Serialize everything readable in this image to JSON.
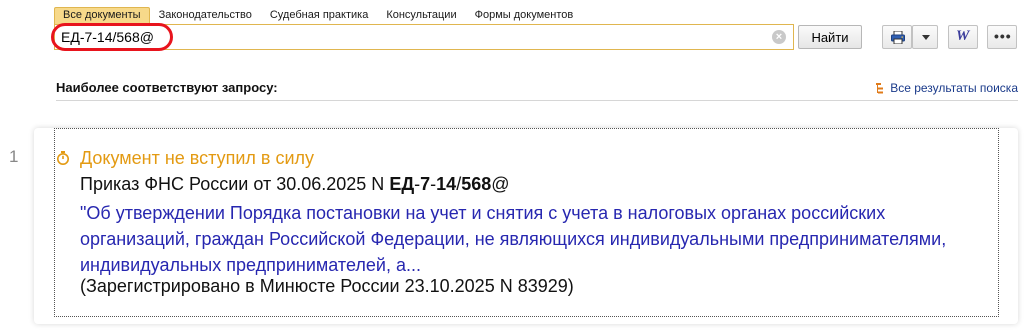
{
  "tabs": [
    {
      "label": "Все документы",
      "active": true
    },
    {
      "label": "Законодательство",
      "active": false
    },
    {
      "label": "Судебная практика",
      "active": false
    },
    {
      "label": "Консультации",
      "active": false
    },
    {
      "label": "Формы документов",
      "active": false
    }
  ],
  "search": {
    "value": "ЕД-7-14/568@",
    "clear_glyph": "×",
    "find_label": "Найти"
  },
  "toolbar": {
    "icons": [
      "print-icon",
      "chevron-down-icon",
      "word-icon",
      "more-icon"
    ],
    "word_glyph": "W",
    "more_glyph": "•••"
  },
  "results": {
    "heading": "Наиболее соответствуют запросу:",
    "all_results_label": "Все результаты поиска"
  },
  "items": [
    {
      "number": "1",
      "status": "Документ не вступил в силу",
      "title_prefix": "Приказ ФНС России от 30.06.2025 N ",
      "title_parts": [
        "ЕД",
        "-",
        "7",
        "-",
        "14",
        "/",
        "568",
        "@"
      ],
      "description": "\"Об утверждении Порядка постановки на учет и снятия с учета в налоговых органах российских организаций, граждан Российской Федерации, не являющихся индивидуальными предпринимателями, индивидуальных предпринимателей, а...",
      "note": "(Зарегистрировано в Минюсте России 23.10.2025 N 83929)"
    }
  ],
  "colors": {
    "tab_active": "#f7d98a",
    "status": "#e39a12",
    "link": "#2727b0",
    "highlight_ring": "#e8141d"
  }
}
